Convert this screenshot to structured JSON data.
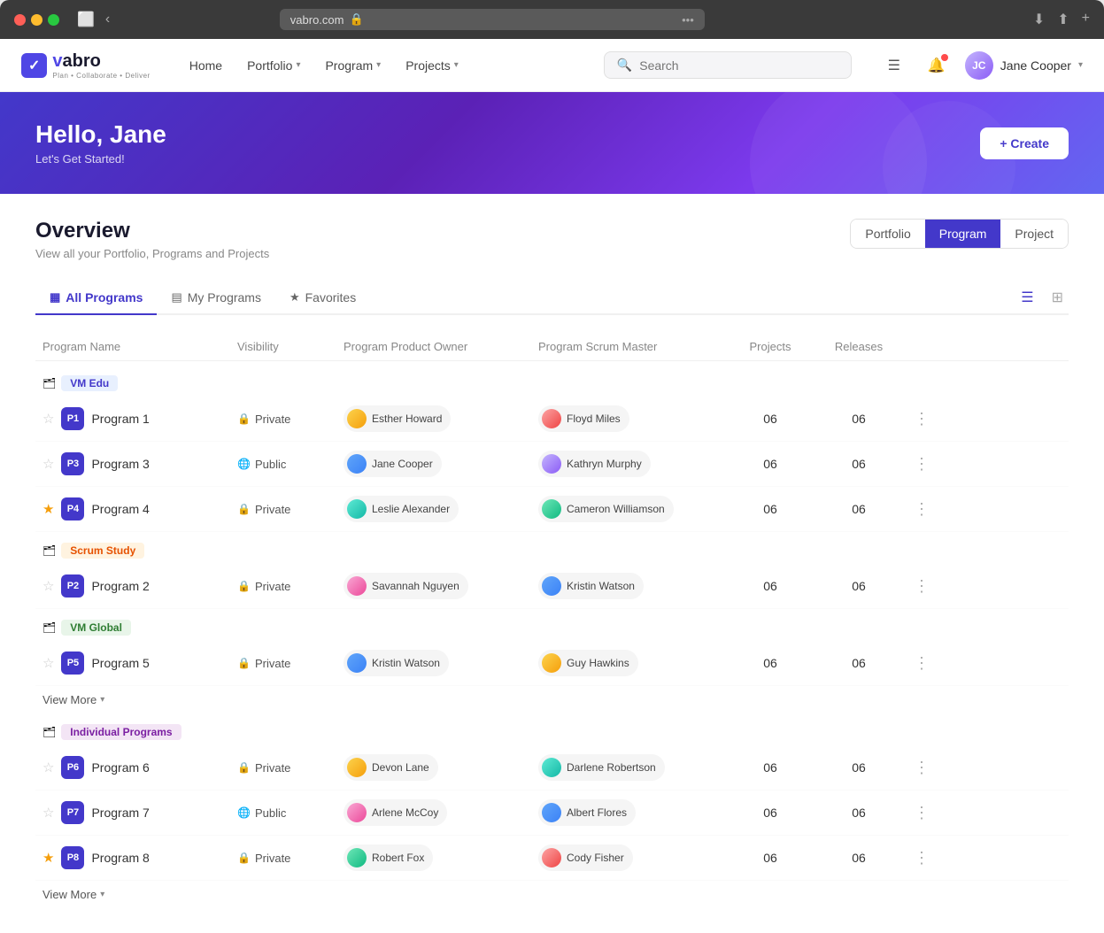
{
  "browser": {
    "url": "vabro.com",
    "lock_icon": "🔒",
    "more_icon": "•••"
  },
  "nav": {
    "logo_icon": "✓",
    "logo_brand": "vabro",
    "logo_tagline": "Plan • Collaborate • Deliver",
    "links": [
      {
        "label": "Home",
        "has_dropdown": false
      },
      {
        "label": "Portfolio",
        "has_dropdown": true
      },
      {
        "label": "Program",
        "has_dropdown": true
      },
      {
        "label": "Projects",
        "has_dropdown": true
      }
    ],
    "search_placeholder": "Search",
    "user_name": "Jane Cooper"
  },
  "hero": {
    "greeting": "Hello, Jane",
    "subtitle": "Let's Get Started!",
    "create_btn": "+ Create"
  },
  "overview": {
    "title": "Overview",
    "subtitle": "View all your Portfolio, Programs and Projects",
    "view_buttons": [
      "Portfolio",
      "Program",
      "Project"
    ],
    "active_view": "Program"
  },
  "tabs": [
    {
      "label": "All Programs",
      "icon": "▦",
      "active": true
    },
    {
      "label": "My Programs",
      "icon": "▤",
      "active": false
    },
    {
      "label": "Favorites",
      "icon": "★",
      "active": false
    }
  ],
  "table_headers": [
    "Program Name",
    "Visibility",
    "Program Product Owner",
    "Program Scrum Master",
    "Projects",
    "Releases",
    ""
  ],
  "groups": [
    {
      "name": "VM Edu",
      "tag": "VM Edu",
      "tag_style": "blue",
      "programs": [
        {
          "id": "P1",
          "name": "Program 1",
          "starred": false,
          "visibility": "Private",
          "visibility_type": "lock",
          "product_owner": "Esther Howard",
          "scrum_master": "Floyd Miles",
          "projects": "06",
          "releases": "06",
          "po_av": "av-orange",
          "sm_av": "av-red"
        },
        {
          "id": "P3",
          "name": "Program 3",
          "starred": false,
          "visibility": "Public",
          "visibility_type": "globe",
          "product_owner": "Jane Cooper",
          "scrum_master": "Kathryn Murphy",
          "projects": "06",
          "releases": "06",
          "po_av": "av-blue",
          "sm_av": "av-purple"
        },
        {
          "id": "P4",
          "name": "Program 4",
          "starred": true,
          "visibility": "Private",
          "visibility_type": "lock",
          "product_owner": "Leslie Alexander",
          "scrum_master": "Cameron Williamson",
          "projects": "06",
          "releases": "06",
          "po_av": "av-teal",
          "sm_av": "av-green"
        }
      ]
    },
    {
      "name": "Scrum Study",
      "tag": "Scrum Study",
      "tag_style": "orange",
      "programs": [
        {
          "id": "P2",
          "name": "Program 2",
          "starred": false,
          "visibility": "Private",
          "visibility_type": "lock",
          "product_owner": "Savannah Nguyen",
          "scrum_master": "Kristin Watson",
          "projects": "06",
          "releases": "06",
          "po_av": "av-pink",
          "sm_av": "av-blue"
        }
      ]
    },
    {
      "name": "VM Global",
      "tag": "VM Global",
      "tag_style": "green",
      "programs": [
        {
          "id": "P5",
          "name": "Program 5",
          "starred": false,
          "visibility": "Private",
          "visibility_type": "lock",
          "product_owner": "Kristin Watson",
          "scrum_master": "Guy Hawkins",
          "projects": "06",
          "releases": "06",
          "po_av": "av-blue",
          "sm_av": "av-orange"
        }
      ],
      "view_more": "View More"
    },
    {
      "name": "Individual Programs",
      "tag": "Individual Programs",
      "tag_style": "purple",
      "programs": [
        {
          "id": "P6",
          "name": "Program 6",
          "starred": false,
          "visibility": "Private",
          "visibility_type": "lock",
          "product_owner": "Devon Lane",
          "scrum_master": "Darlene Robertson",
          "projects": "06",
          "releases": "06",
          "po_av": "av-orange",
          "sm_av": "av-teal"
        },
        {
          "id": "P7",
          "name": "Program 7",
          "starred": false,
          "visibility": "Public",
          "visibility_type": "globe",
          "product_owner": "Arlene McCoy",
          "scrum_master": "Albert Flores",
          "projects": "06",
          "releases": "06",
          "po_av": "av-pink",
          "sm_av": "av-blue"
        },
        {
          "id": "P8",
          "name": "Program 8",
          "starred": true,
          "visibility": "Private",
          "visibility_type": "lock",
          "product_owner": "Robert Fox",
          "scrum_master": "Cody Fisher",
          "projects": "06",
          "releases": "06",
          "po_av": "av-green",
          "sm_av": "av-red"
        }
      ],
      "view_more": "View More"
    }
  ],
  "more_label": "More",
  "view_more_label": "View More"
}
